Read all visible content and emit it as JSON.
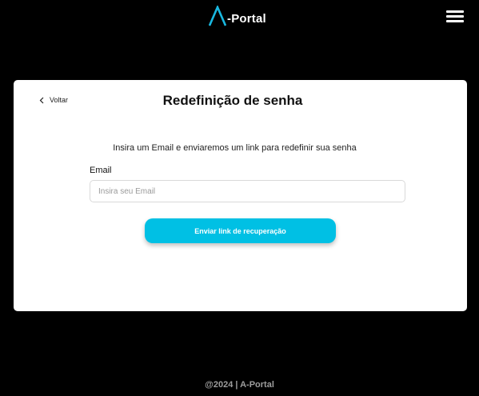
{
  "header": {
    "logo_text": "-Portal",
    "menu_icon": "hamburger-menu-icon",
    "logo_icon": "a-logo-icon"
  },
  "card": {
    "back_label": "Voltar",
    "back_icon": "chevron-left-icon",
    "title": "Redefinição de senha",
    "instruction": "Insira um Email e enviaremos um link para redefinir sua senha",
    "email_label": "Email",
    "email_placeholder": "Insira seu Email",
    "email_value": "",
    "submit_label": "Enviar link de recuperação"
  },
  "footer": {
    "text": "@2024 | A-Portal"
  },
  "colors": {
    "background": "#000000",
    "card": "#ffffff",
    "accent": "#00c0e4",
    "logo_accent": "#19b8e0",
    "footer_text": "#9e9e9e"
  }
}
